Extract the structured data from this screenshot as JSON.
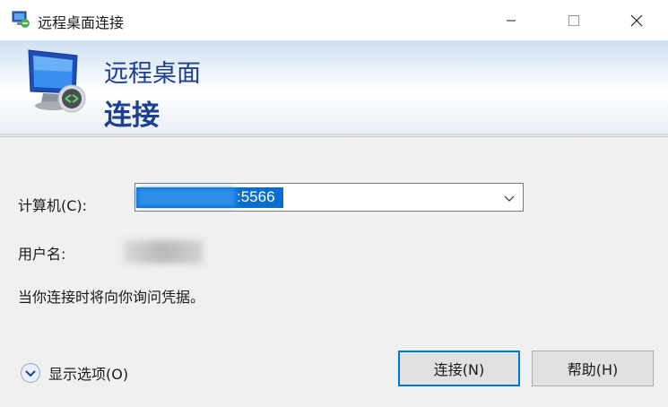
{
  "window": {
    "title": "远程桌面连接",
    "icon": "remote-desktop-icon",
    "controls": [
      "minimize",
      "maximize",
      "close"
    ]
  },
  "banner": {
    "subtitle": "远程桌面",
    "title": "连接",
    "icon": "monitor-connection-icon"
  },
  "form": {
    "computer_label": "计算机(C):",
    "computer_value": ":5566",
    "username_label": "用户名:",
    "notice": "当你连接时将向你询问凭据。"
  },
  "footer": {
    "options_label": "显示选项(O)",
    "connect_label": "连接(N)",
    "help_label": "帮助(H)"
  },
  "colors": {
    "accent": "#0078d7",
    "banner_text": "#1c3f8f",
    "selection": "#0a6ed1"
  }
}
